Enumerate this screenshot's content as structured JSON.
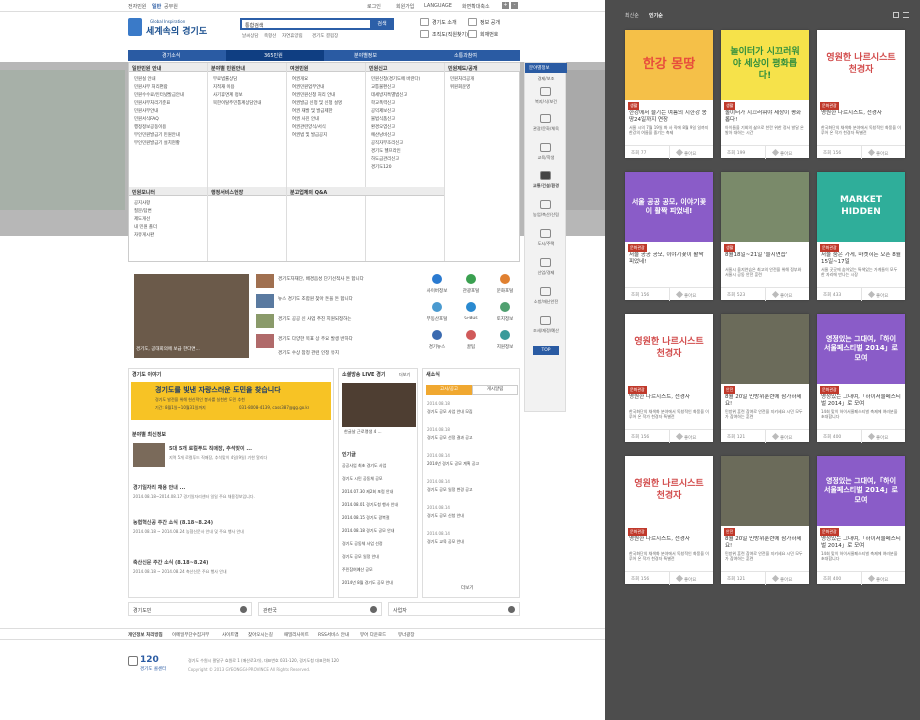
{
  "topbar": {
    "items": [
      "전자민원",
      "일반",
      "공무원"
    ],
    "login": "로그인",
    "join": "회원가입",
    "language": "LANGUAGE",
    "font_size": "화면확대축소",
    "plus": "+",
    "minus": "-"
  },
  "header": {
    "logo_sub": "Global Inspiration",
    "logo": "세계속의 경기도",
    "search_scope": "통합검색",
    "search_button": "검색",
    "search_links": [
      "날씨상담",
      "축항산",
      "자연휴양림",
      "경기도 결핍장"
    ],
    "quick": [
      "경기도 소개",
      "정보 공개",
      "조직도(직원찾기)",
      "회재번호"
    ]
  },
  "mainnav": [
    "경기소식",
    "365민원",
    "분야별정보",
    "소통과참여"
  ],
  "mega": {
    "cols": [
      {
        "title": "일반민원 안내",
        "items": [
          "민원실 안내",
          "민원사무 처리편람",
          "민원수수료/인터넷발급안내",
          "민원사무처리기준표",
          "민원사무안내",
          "민원서식FAQ",
          "행정정보공동이용",
          "무인민원발급기 민원안내",
          "무인민원발급기 설치현황"
        ]
      },
      {
        "title": "분야별 민원안내",
        "items": [
          "무료법률상담",
          "지적재 이용",
          "사기휴면계 정보",
          "북한이탈주민통계상담안내"
        ]
      },
      {
        "title": "여권민원",
        "items": [
          "여권개요",
          "여권민원업무안내",
          "여권민원신청 처리 안내",
          "여권발급 신청 및 신청 설명",
          "여권 재발 및 발급제한",
          "여권 사진 안내",
          "여권관련양식/서식",
          "여권법 및 발급공지"
        ]
      },
      {
        "title": "민원신고",
        "items": [
          "민원신청(경기도에 바란다)",
          "교통불편신고",
          "데세방지특별법신고",
          "학교폭력신고",
          "공익제보신고",
          "불법식품신고",
          "환경오염신고",
          "예산낭비신고",
          "공직자부조리신고",
          "경기도 헬프라인",
          "하도급관리신고",
          "경기도120"
        ]
      },
      {
        "title": "민원제도/공개",
        "items": [
          "민원처리공개",
          "위원회운영"
        ]
      }
    ],
    "cols2": [
      {
        "title": "민원모니터",
        "items": [
          "공지사항",
          "질문/답변",
          "제도개선",
          "내 민원 폴더",
          "자유게시판"
        ]
      },
      {
        "title": "행정서비스헌장",
        "items": []
      },
      {
        "title": "분고업체의 Q&A",
        "items": []
      }
    ],
    "right_links": [
      "경기 대표 키워드",
      "가이드 매니저"
    ]
  },
  "minibar": {
    "title": "분야별정보",
    "items": [
      "경제/보조",
      "복지/식/보건",
      "관광/문화/체육",
      "교육/학생",
      "교통/건설/환경",
      "농업/축산/산림",
      "도시/주택",
      "산업/경제",
      "소방/재난안전",
      "조세/재정/예산"
    ],
    "top": "TOP"
  },
  "news": {
    "headline_caption": "경기도, 공대회의에 보급 한다면...",
    "items": [
      "경기도자재단, 배경음성 단기선적사 돈 합니다",
      "뉴스 경기도 조합원 찾아 돈을 돈 합니다",
      "경기도 공공 신 사업 추진 지원되정하는",
      "경기도 다양한 목표 상 주요 발생 반하다",
      "경기도 수상 참정 관련 인정 유지"
    ]
  },
  "svc": {
    "labels": [
      "사이버정보",
      "관광포털",
      "문화포털",
      "부동산포털",
      "G-Bus",
      "토지정보",
      "경기뉴스",
      "꿀팁",
      "지원정보"
    ]
  },
  "story": {
    "title": "경기도 이야기",
    "banner": "경기도를 빛낸 자랑스러운 도민을 찾습니다",
    "banner_sub": "경기도 발전을 위해 헌신적인 봉사를 실천한 도민 추천",
    "banner_date": "기간: 8월1일~10월31일까지",
    "banner_phone": "031-8008-4139, cass387@gg.go.kr"
  },
  "field": {
    "title": "분야별 최신정보",
    "headline": "5대 5개 로컬푸드 직매장, 추석맞이 ...",
    "headline_sub": "지역 5개 로컬푸드 직매장, 추석맞이 4일(9일) 기한 알리다",
    "items": [
      {
        "t": "경기일자리 채용 안내 ...",
        "d": "2014.08.18~2014.08.17 경기일자리센터 일일 주요 채용정보입니다."
      },
      {
        "t": "농협혁신공 주간 소식 (8.18~8.24)",
        "d": "2014.08.18 ~ 2014.08.24 농협신문사 안내 및 주요 행사 안내"
      },
      {
        "t": "축산신문 주간 소식 (8.18~8.24)",
        "d": "2014.08.18 ~ 2014.08.24 축산신문 주요 행사 안내"
      }
    ]
  },
  "social": {
    "title": "소셜방송 LIVE 경기",
    "more": "더보기",
    "video_caption": "한글날 근로맹생 4 ...",
    "sub": "인기글",
    "items": [
      "공공사업 최초 경기도 사업",
      "경기도 시민 공동체 공모",
      "2014.07.30 제2회 포럼 안내",
      "2014.08.01 경기도청 행사 안내",
      "2014.08.15 경기도 광복절",
      "2014.08.18 경기도 공모 안내",
      "경기도 공동체 사업 선정",
      "경기도 공모 일정 안내",
      "주민참여예산 공모",
      "2014년 8월 경기도 공모 안내"
    ]
  },
  "notice": {
    "title": "새소식",
    "tabs": [
      "고시/공고",
      "게시알림"
    ],
    "items": [
      {
        "d": "2014.08.18",
        "t": "경기도 공모 사업 안내 모집"
      },
      {
        "d": "2014.08.18",
        "t": "경기도 공모 선정 결과 공고"
      },
      {
        "d": "2014.08.14",
        "t": "2014년 경기도 공모 계획 공고"
      },
      {
        "d": "2014.08.14",
        "t": "경기도 공모 일정 변경 공고"
      },
      {
        "d": "2014.08.14",
        "t": "경기도 공모 신청 안내"
      },
      {
        "d": "2014.08.14",
        "t": "경기도 교육 공모 안내"
      }
    ],
    "more": "더보기"
  },
  "selects": [
    "경기도민",
    "관련국",
    "사업자"
  ],
  "footer": {
    "links": [
      "개인정보 처리방침",
      "이메일무단수집거부",
      "사이트맵",
      "찾아오시는길",
      "패밀리사이트",
      "RSS서비스 안내",
      "뷰어 다운로드",
      "뷰너광장"
    ],
    "address": "경기도 수원시 팔달구 효원로 1 (매산로3가), 대표번호 031-120, 경기도청 대표전화 120",
    "copyright": "Copyright © 2013 GYEONGGI-PROVINCE All Rights Reserved.",
    "call": "120",
    "call_name": "경기도 콜센터"
  },
  "right": {
    "tabs": [
      "최신순",
      "인기순"
    ],
    "cards": [
      {
        "img": "한강 몽땅",
        "tag": "생활",
        "title": "한강에서 즐기는 여름의 시한강 몽땅24일까지 연장",
        "desc": "서울 시의 7월 19일 화 사 직에 8월 9일 일까지 한강의 여름을 즐기는 축제",
        "views": "조회 77",
        "like": "좋아요",
        "bg": "#f5c048",
        "fg": "#e74c3c"
      },
      {
        "img": "놀이터가 시끄러워야 세상이 평화롭다!",
        "tag": "생활",
        "title": "놀이터가 시끄러워야 세상이 평화롭다!",
        "desc": "아이들을 기회의 삶으로 찬란 위한 정서 발달 온 발아 대하는 시간",
        "views": "조회 199",
        "like": "좋아요",
        "bg": "#f6e24a",
        "fg": "#2f8e3e"
      },
      {
        "img": "영원한 나르시스트 천경자",
        "tag": "문화관광",
        "title": "영원한 나르시스트, 천경자",
        "desc": "한국화단의 채색화 분야에서 독창적인 화풍을 이루어 온 작가 천경자 특별전",
        "views": "조회 156",
        "like": "좋아요",
        "bg": "#fff",
        "fg": "#d24b4b"
      },
      {
        "img": "서울 공공 공모, 이야기꽃이 활짝 피었네!",
        "tag": "문화관광",
        "title": "서울 공공 공모, 이야기꽃이 활짝 피었네!",
        "desc": "",
        "views": "조회 156",
        "like": "좋아요",
        "bg": "#8a5cc8",
        "fg": "#fff"
      },
      {
        "img": "",
        "tag": "생활",
        "title": "8월18일~21일 '을지연습'",
        "desc": "서울시 을지연습은 최고의 안전을 위해 정부와 서울시 공동 안전 훈련",
        "views": "조회 523",
        "like": "좋아요",
        "bg": "#7a8a6a",
        "fg": "#fff"
      },
      {
        "img": "MARKET HIDDEN",
        "tag": "문화관광",
        "title": "서울 숨은 가게, 마켓히든 오픈 8월15일~17일",
        "desc": "서울 곳곳에 숨어있는 특색있는 가게들이 모두 한 자리에 만나는 시장",
        "views": "조회 433",
        "like": "좋아요",
        "bg": "#2fae9a",
        "fg": "#fff"
      },
      {
        "img": "영원한 나르시스트 천경자",
        "tag": "문화관광",
        "title": "영원한 나르시스트, 천경자",
        "desc": "한국화단의 채색화 분야에서 독창적인 화풍을 이루어 온 작가 천경자 특별전",
        "views": "조회 156",
        "like": "좋아요",
        "bg": "#fff",
        "fg": "#d24b4b"
      },
      {
        "img": "",
        "tag": "안전",
        "title": "8월 20일 민방위훈련에 참가하세요!",
        "desc": "민방위 훈련 참여로 안전을 지키세요 시민 모두가 참여하는 훈련",
        "views": "조회 121",
        "like": "좋아요",
        "bg": "#6b6b5a",
        "fg": "#fff"
      },
      {
        "img": "영정있는 그대여,「하이서울페스티벌 2014」로 모여",
        "tag": "문화관광",
        "title": "영정있는 그대여,「하이서울페스티벌 2014」로 모여",
        "desc": "14회 맞이 하이서울페스티벌 축제에 여러분을 초대합니다",
        "views": "조회 400",
        "like": "좋아요",
        "bg": "#8a5cc8",
        "fg": "#fff"
      },
      {
        "img": "영원한 나르시스트 천경자",
        "tag": "문화관광",
        "title": "영원한 나르시스트, 천경자",
        "desc": "한국화단의 채색화 분야에서 독창적인 화풍을 이루어 온 작가 천경자 특별전",
        "views": "조회 156",
        "like": "좋아요",
        "bg": "#fff",
        "fg": "#d24b4b"
      },
      {
        "img": "",
        "tag": "안전",
        "title": "8월 20일 민방위훈련에 참가하세요!",
        "desc": "민방위 훈련 참여로 안전을 지키세요 시민 모두가 참여하는 훈련",
        "views": "조회 121",
        "like": "좋아요",
        "bg": "#6b6b5a",
        "fg": "#fff"
      },
      {
        "img": "영정있는 그대여,「하이서울페스티벌 2014」로 모여",
        "tag": "문화관광",
        "title": "영정있는 그대여,「하이서울페스티벌 2014」로 모여",
        "desc": "14회 맞이 하이서울페스티벌 축제에 여러분을 초대합니다",
        "views": "조회 400",
        "like": "좋아요",
        "bg": "#8a5cc8",
        "fg": "#fff"
      }
    ]
  }
}
